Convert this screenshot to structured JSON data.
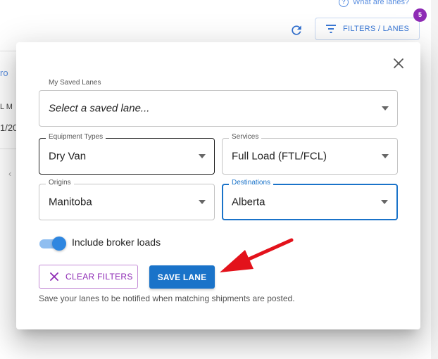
{
  "background": {
    "help_link": "What are lanes?",
    "filters_button": "FILTERS / LANES",
    "filters_badge": "5",
    "fragments": [
      "ro",
      "L M",
      "1/20",
      "‹"
    ]
  },
  "modal": {
    "saved_lanes": {
      "label": "My Saved Lanes",
      "placeholder": "Select a saved lane..."
    },
    "equipment": {
      "label": "Equipment Types",
      "value": "Dry Van"
    },
    "services": {
      "label": "Services",
      "value": "Full Load (FTL/FCL)"
    },
    "origins": {
      "label": "Origins",
      "value": "Manitoba"
    },
    "destinations": {
      "label": "Destinations",
      "value": "Alberta"
    },
    "broker_toggle": {
      "label": "Include broker loads",
      "on": true
    },
    "clear_button": "CLEAR FILTERS",
    "save_button": "SAVE LANE",
    "hint": "Save your lanes to be notified when matching shipments are posted."
  },
  "colors": {
    "primary": "#1a73c9",
    "accent": "#8e2bb5",
    "annotation_arrow": "#e3121b"
  }
}
